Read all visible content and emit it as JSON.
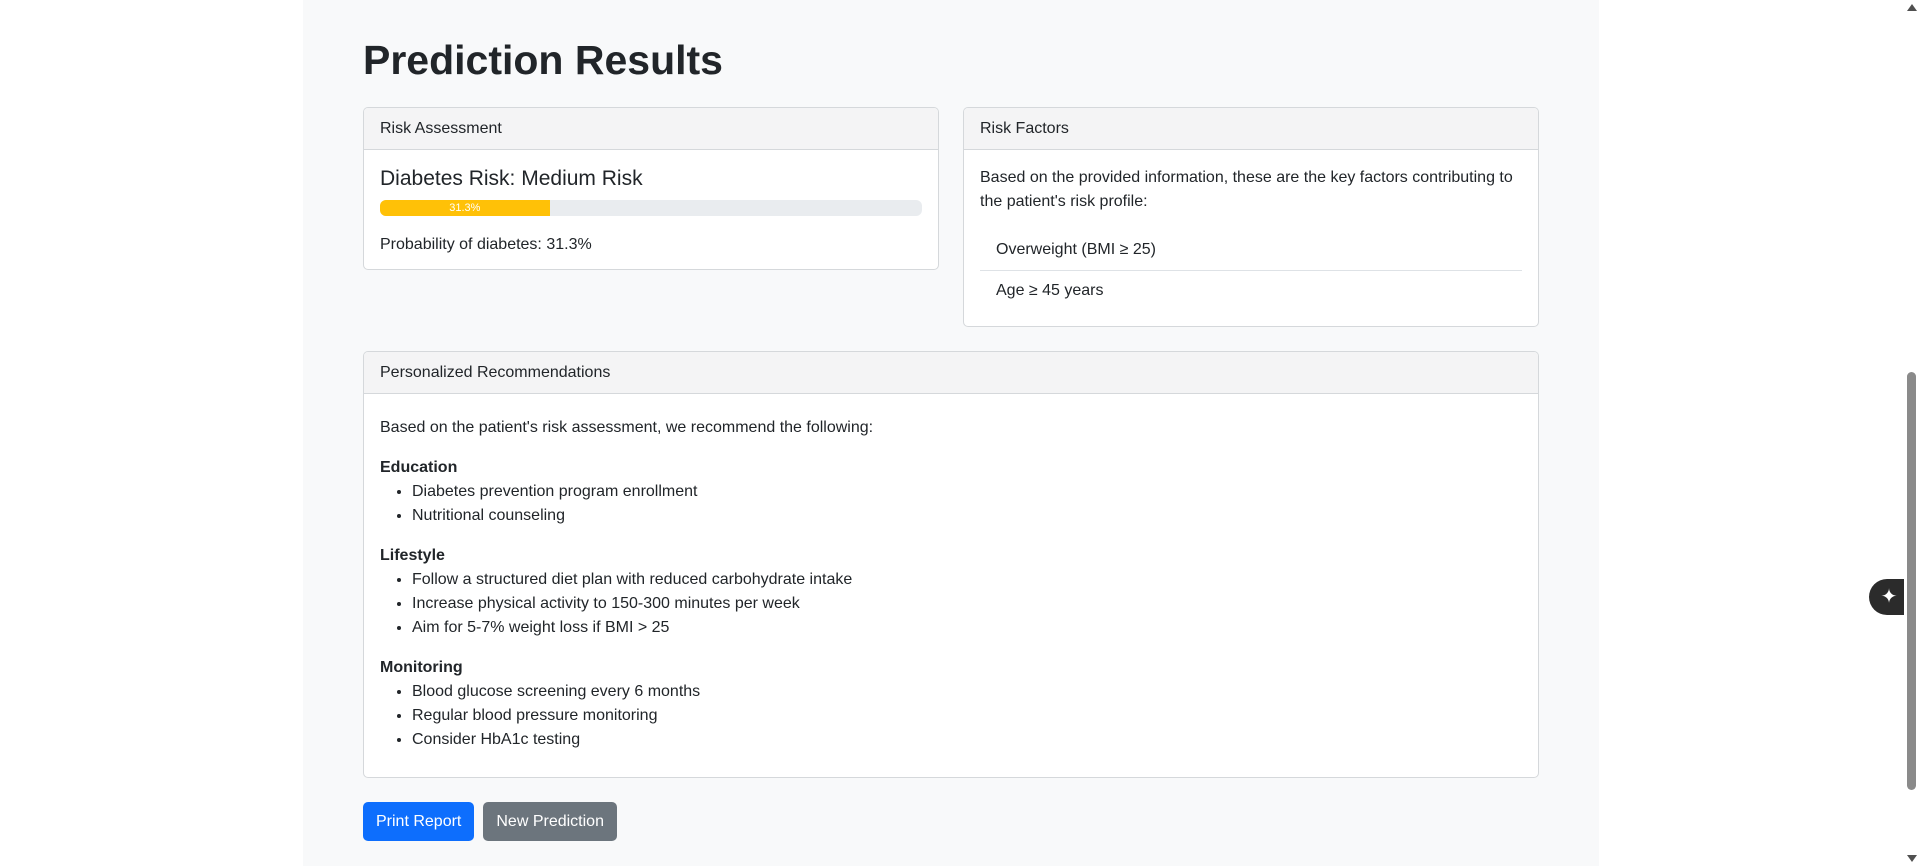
{
  "page_title": "Prediction Results",
  "risk_card": {
    "header": "Risk Assessment",
    "title": "Diabetes Risk: Medium Risk",
    "progress_label": "31.3%",
    "progress_fraction": 0.313,
    "progress_color": "#ffc107",
    "probability_text": "Probability of diabetes: 31.3%"
  },
  "factors_card": {
    "header": "Risk Factors",
    "intro": "Based on the provided information, these are the key factors contributing to the patient's risk profile:",
    "items": [
      "Overweight (BMI ≥ 25)",
      "Age ≥ 45 years"
    ]
  },
  "recs_card": {
    "header": "Personalized Recommendations",
    "intro": "Based on the patient's risk assessment, we recommend the following:",
    "sections": [
      {
        "title": "Education",
        "items": [
          "Diabetes prevention program enrollment",
          "Nutritional counseling"
        ]
      },
      {
        "title": "Lifestyle",
        "items": [
          "Follow a structured diet plan with reduced carbohydrate intake",
          "Increase physical activity to 150-300 minutes per week",
          "Aim for 5-7% weight loss if BMI > 25"
        ]
      },
      {
        "title": "Monitoring",
        "items": [
          "Blood glucose screening every 6 months",
          "Regular blood pressure monitoring",
          "Consider HbA1c testing"
        ]
      }
    ]
  },
  "buttons": {
    "print": "Print Report",
    "new": "New Prediction"
  },
  "colors": {
    "primary": "#0d6efd",
    "secondary": "#6c757d",
    "warning": "#ffc107"
  },
  "icons": {
    "assistant": "sparkle-icon"
  }
}
